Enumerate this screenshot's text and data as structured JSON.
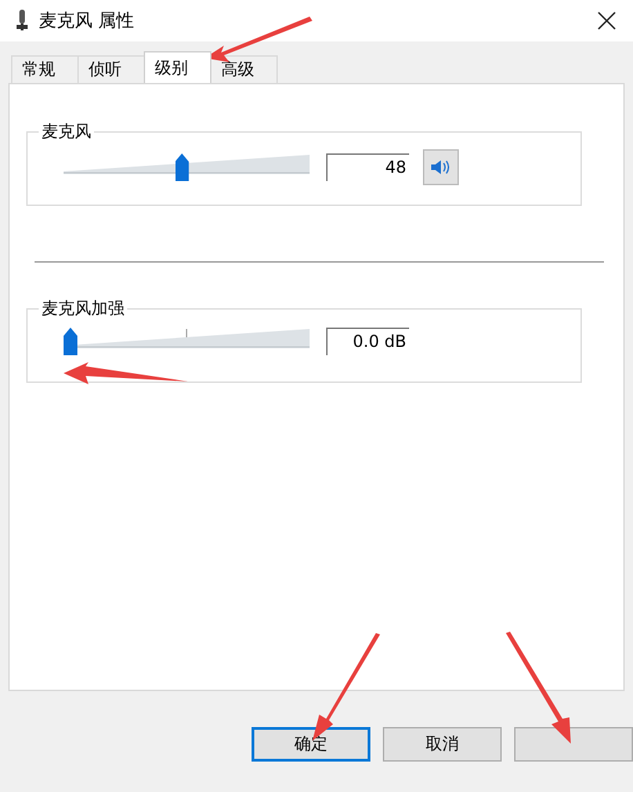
{
  "window": {
    "title": "麦克风 属性"
  },
  "tabs": [
    {
      "label": "常规",
      "selected": false
    },
    {
      "label": "侦听",
      "selected": false
    },
    {
      "label": "级别",
      "selected": true
    },
    {
      "label": "高级",
      "selected": false
    }
  ],
  "groups": [
    {
      "kind": "volume",
      "label": "麦克风",
      "level": 0.48,
      "value": "48"
    },
    {
      "kind": "boost",
      "label": "麦克风加强",
      "level": 0,
      "value": "0.0 dB"
    }
  ],
  "buttons": [
    {
      "label": "确定",
      "default": true
    },
    {
      "label": "取消",
      "default": false
    },
    {
      "default": false
    }
  ]
}
